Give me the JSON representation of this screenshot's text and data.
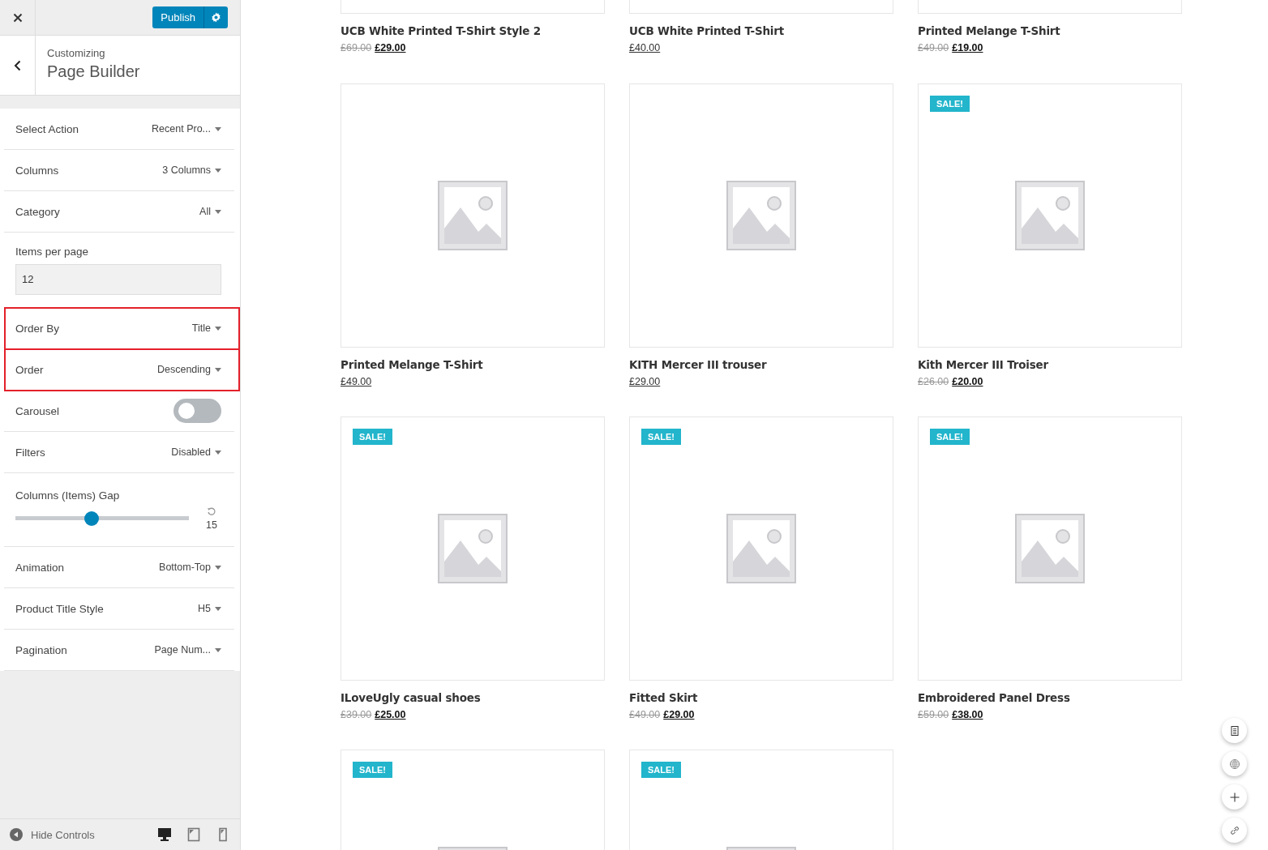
{
  "topbar": {
    "publish": "Publish"
  },
  "header": {
    "subtitle": "Customizing",
    "title": "Page Builder"
  },
  "controls": [
    {
      "kind": "select",
      "label": "Select Action",
      "value": "Recent Pro...",
      "highlighted": false
    },
    {
      "kind": "select",
      "label": "Columns",
      "value": "3 Columns",
      "highlighted": false
    },
    {
      "kind": "select",
      "label": "Category",
      "value": "All",
      "highlighted": false
    },
    {
      "kind": "input",
      "label": "Items per page",
      "value": "12",
      "highlighted": false
    },
    {
      "kind": "select",
      "label": "Order By",
      "value": "Title",
      "highlighted": true
    },
    {
      "kind": "select",
      "label": "Order",
      "value": "Descending",
      "highlighted": true
    },
    {
      "kind": "toggle",
      "label": "Carousel",
      "on": false,
      "highlighted": false
    },
    {
      "kind": "select",
      "label": "Filters",
      "value": "Disabled",
      "highlighted": false
    },
    {
      "kind": "slider",
      "label": "Columns (Items) Gap",
      "level": 0.44,
      "value": "15",
      "highlighted": false
    },
    {
      "kind": "select",
      "label": "Animation",
      "value": "Bottom-Top",
      "highlighted": false
    },
    {
      "kind": "select",
      "label": "Product Title Style",
      "value": "H5",
      "highlighted": false
    },
    {
      "kind": "select",
      "label": "Pagination",
      "value": "Page Num...",
      "highlighted": false
    }
  ],
  "footer": {
    "label": "Hide Controls",
    "devices": [
      {
        "kind": "desktop",
        "selected": true
      },
      {
        "kind": "tablet",
        "selected": false
      },
      {
        "kind": "mobile",
        "selected": false
      }
    ]
  },
  "products": [
    {
      "kind": "partial",
      "title": "UCB White Printed T-Shirt Style 2",
      "old_price": "£69.00",
      "price": "£29.00"
    },
    {
      "kind": "partial",
      "title": "UCB White Printed T-Shirt",
      "price": "£40.00"
    },
    {
      "kind": "partial",
      "title": "Printed Melange T-Shirt",
      "old_price": "£49.00",
      "price": "£19.00"
    },
    {
      "kind": "full",
      "title": "Printed Melange T-Shirt",
      "price": "£49.00"
    },
    {
      "kind": "full",
      "title": "KITH Mercer III trouser",
      "price": "£29.00"
    },
    {
      "kind": "full",
      "badge": "SALE!",
      "title": "Kith Mercer III Troiser",
      "old_price": "£26.00",
      "price": "£20.00"
    },
    {
      "kind": "full",
      "badge": "SALE!",
      "title": "ILoveUgly casual shoes",
      "old_price": "£39.00",
      "price": "£25.00"
    },
    {
      "kind": "full",
      "badge": "SALE!",
      "title": "Fitted Skirt",
      "old_price": "£49.00",
      "price": "£29.00"
    },
    {
      "kind": "full",
      "badge": "SALE!",
      "title": "Embroidered Panel Dress",
      "old_price": "£59.00",
      "price": "£38.00"
    },
    {
      "kind": "full",
      "badge": "SALE!"
    },
    {
      "kind": "full",
      "badge": "SALE!"
    }
  ],
  "float_actions": [
    {
      "kind": "document"
    },
    {
      "kind": "globe"
    },
    {
      "kind": "plus"
    },
    {
      "kind": "link"
    }
  ]
}
